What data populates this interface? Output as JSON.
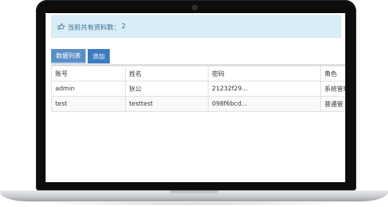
{
  "info": {
    "text": "当前共有资料数：",
    "count": "2",
    "icon": "hand-point-right-icon"
  },
  "tabs": [
    {
      "label": "数据列表"
    },
    {
      "label": "添加"
    }
  ],
  "table": {
    "headers": [
      "账号",
      "姓名",
      "密码",
      "角色"
    ],
    "rows": [
      [
        "admin",
        "狄公",
        "21232f29...",
        "系统管理"
      ],
      [
        "test",
        "testtest",
        "098f6bcd...",
        "普通管"
      ]
    ]
  },
  "colors": {
    "info_bg": "#d9edf7",
    "tab_list_bg": "#5b8fc7",
    "tab_add_bg": "#3b7bc0"
  }
}
